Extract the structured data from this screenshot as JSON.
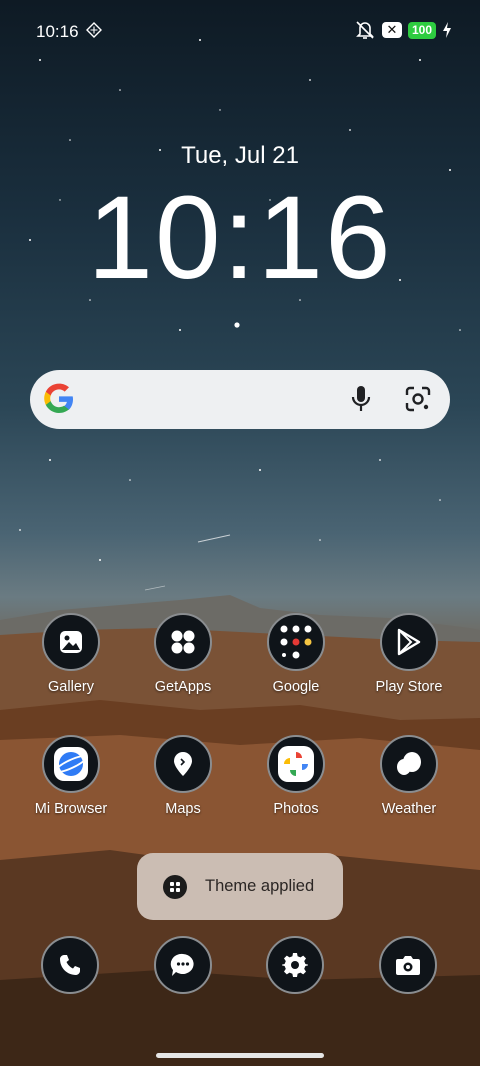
{
  "status_bar": {
    "time": "10:16",
    "battery": "100",
    "icons": [
      "tile-icon",
      "bell-off-icon",
      "x-badge-icon",
      "battery-icon",
      "charging-bolt-icon"
    ]
  },
  "lockclock": {
    "date": "Tue, Jul 21",
    "time": "10:16"
  },
  "search_bar": {
    "icons": [
      "google-g-icon",
      "mic-icon",
      "lens-icon"
    ]
  },
  "apps": [
    {
      "label": "Gallery",
      "icon": "gallery-icon"
    },
    {
      "label": "GetApps",
      "icon": "getapps-icon"
    },
    {
      "label": "Google",
      "icon": "google-folder-icon"
    },
    {
      "label": "Play Store",
      "icon": "play-store-icon"
    },
    {
      "label": "Mi Browser",
      "icon": "browser-icon"
    },
    {
      "label": "Maps",
      "icon": "maps-icon"
    },
    {
      "label": "Photos",
      "icon": "photos-icon"
    },
    {
      "label": "Weather",
      "icon": "weather-icon"
    }
  ],
  "toast": {
    "text": "Theme applied"
  },
  "dock": [
    {
      "icon": "phone-icon"
    },
    {
      "icon": "messages-icon"
    },
    {
      "icon": "settings-icon"
    },
    {
      "icon": "camera-icon"
    }
  ]
}
